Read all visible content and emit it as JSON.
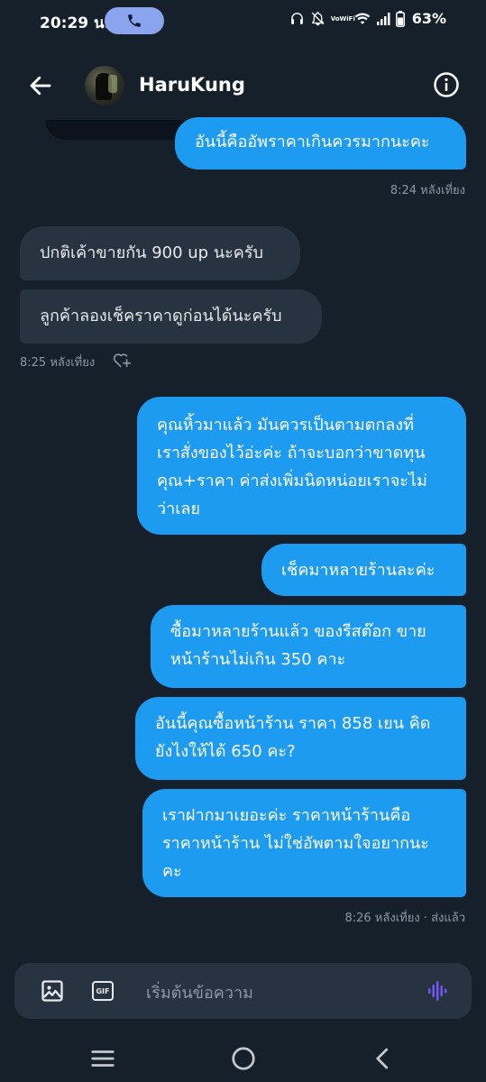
{
  "status_bar": {
    "time": "20:29 น.",
    "battery": "63%",
    "volte_label": "VoWiFi"
  },
  "header": {
    "contact_name": "HaruKung"
  },
  "messages": [
    {
      "side": "sent",
      "text": "อันนี้คืออัพราคาเกินควรมากนะคะ"
    },
    {
      "side": "recv",
      "text": "ปกติเค้าขายกัน 900 up นะครับ"
    },
    {
      "side": "recv",
      "text": "ลูกค้าลองเช็คราคาดูก่อนได้นะครับ"
    },
    {
      "side": "sent",
      "lines": [
        "คุณหิ้วมาแล้ว มันควรเป็นตามตกลงที่",
        "เราสั่งของไว้อ่ะค่ะ ถ้าจะบอกว่าขาดทุน",
        "คุณ+ราคา ค่าส่งเพิ่มนิดหน่อยเราจะไม่",
        "ว่าเลย"
      ]
    },
    {
      "side": "sent",
      "text": "เช็คมาหลายร้านละค่ะ"
    },
    {
      "side": "sent",
      "lines": [
        "ซื้อมาหลายร้านแล้ว ของรีสต๊อก ขาย",
        "หน้าร้านไม่เกิน 350 คาะ"
      ]
    },
    {
      "side": "sent",
      "lines": [
        "อันนี้คุณซื้อหน้าร้าน ราคา 858 เยน คิด",
        "ยังไงให้ได้ 650 คะ?"
      ]
    },
    {
      "side": "sent",
      "lines": [
        "เราฝากมาเยอะค่ะ ราคาหน้าร้านคือ",
        "ราคาหน้าร้าน ไม่ใช่อัพตามใจอยากนะ",
        "คะ"
      ]
    }
  ],
  "timestamps": {
    "t1": "8:24 หลังเที่ยง",
    "t2": "8:25 หลังเที่ยง",
    "t3": "8:26 หลังเที่ยง · ส่งแล้ว"
  },
  "composer": {
    "placeholder": "เริ่มต้นข้อความ",
    "gif_label": "GIF"
  },
  "colors": {
    "background": "#15202b",
    "sent_bubble": "#1d9bf0",
    "received_bubble": "#273340",
    "voice_accent": "#7856ff"
  },
  "icons": {
    "back": "arrow-left-icon",
    "info": "info-icon",
    "like": "heart-plus-icon",
    "image": "image-icon",
    "gif": "gif-icon",
    "voice": "voice-wave-icon"
  }
}
